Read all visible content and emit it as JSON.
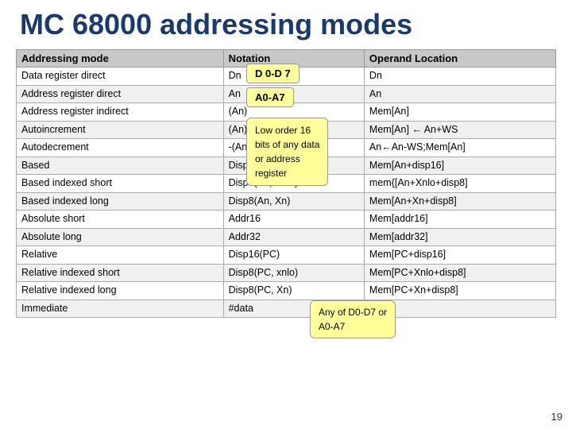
{
  "slide": {
    "title": "MC 68000 addressing modes",
    "table": {
      "headers": [
        "Addressing mode",
        "Notation",
        "Operand Location"
      ],
      "rows": [
        [
          "Data register direct",
          "Dn",
          "Dn"
        ],
        [
          "Address register direct",
          "An",
          "An"
        ],
        [
          "Address register indirect",
          "(An)",
          "Mem[An]"
        ],
        [
          "Autoincrement",
          "(An)+",
          "Mem[An]  ←  An+WS"
        ],
        [
          "Autodecrement",
          "-(An)",
          "An←An-WS;Mem[An]"
        ],
        [
          "Based",
          "Disp16(An)",
          "Mem[An+disp16]"
        ],
        [
          "Based indexed short",
          "Disp8(An, Xnlo)",
          "mem{[An+Xnlo+disp8]"
        ],
        [
          "Based indexed long",
          "Disp8(An, Xn)",
          "Mem[An+Xn+disp8]"
        ],
        [
          "Absolute short",
          "Addr16",
          "Mem[addr16]"
        ],
        [
          "Absolute long",
          "Addr32",
          "Mem[addr32]"
        ],
        [
          "Relative",
          "Disp16(PC)",
          "Mem[PC+disp16]"
        ],
        [
          "Relative indexed short",
          "Disp8(PC, xnlo)",
          "Mem[PC+Xnlo+disp8]"
        ],
        [
          "Relative indexed long",
          "Disp8(PC, Xn)",
          "Mem[PC+Xn+disp8]"
        ],
        [
          "Immediate",
          "#data",
          "nil"
        ]
      ]
    },
    "tooltips": {
      "d0d7": "D 0-D 7",
      "a0a7": "A0-A7",
      "loworder": "Low order 16\nbits of any data\nor address\nregister",
      "anyd0d7": "Any of D0-D7 or\nA0-A7"
    },
    "page_number": "19"
  }
}
